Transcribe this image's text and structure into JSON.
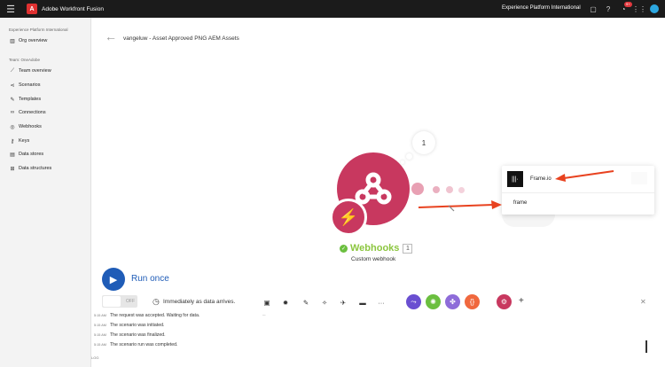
{
  "topbar": {
    "app_title": "Adobe Workfront Fusion",
    "org_name": "Experience Platform International",
    "notification_count": "9+",
    "icons": [
      "menu-icon",
      "chat-icon",
      "help-icon",
      "bell-icon",
      "apps-grid-icon",
      "avatar"
    ]
  },
  "sidebar": {
    "org_section": "Experience Platform International",
    "org_overview": "Org overview",
    "team_section": "Team: OneAdobe",
    "items": [
      {
        "label": "Team overview",
        "icon": "chart-icon"
      },
      {
        "label": "Scenarios",
        "icon": "share-icon"
      },
      {
        "label": "Templates",
        "icon": "puzzle-icon"
      },
      {
        "label": "Connections",
        "icon": "link-icon"
      },
      {
        "label": "Webhooks",
        "icon": "globe-icon"
      },
      {
        "label": "Keys",
        "icon": "key-icon"
      },
      {
        "label": "Data stores",
        "icon": "database-icon"
      },
      {
        "label": "Data structures",
        "icon": "structure-icon"
      }
    ]
  },
  "scenario": {
    "title": "vangeluw - Asset Approved PNG AEM Assets",
    "bubble_count": "1",
    "module_name": "Webhooks",
    "module_number": "1",
    "module_subtitle": "Custom webhook"
  },
  "popup": {
    "app_result": "Frame.io",
    "app_icon_text": "|||·",
    "search_value": "frame"
  },
  "toolbar": {
    "run_label": "Run once",
    "toggle_label": "OFF",
    "schedule_label": "Immediately as data arrives.",
    "save_sublabel": "—",
    "app_colors": [
      "#6a4fd1",
      "#6bbf3f",
      "#8e6cd9",
      "#f0683e",
      "#c8385f"
    ]
  },
  "log": {
    "label": "LOG",
    "entries": [
      {
        "time": "5:15 AM",
        "message": "The request was accepted. Waiting for data."
      },
      {
        "time": "5:15 AM",
        "message": "The scenario was initiated."
      },
      {
        "time": "5:15 AM",
        "message": "The scenario was finalized."
      },
      {
        "time": "5:15 AM",
        "message": "The scenario run was completed."
      }
    ]
  },
  "colors": {
    "webhook_module": "#c8385f",
    "run_button": "#1f5cb7",
    "annotation_arrow": "#e8421f",
    "success_green": "#8cc63f"
  }
}
